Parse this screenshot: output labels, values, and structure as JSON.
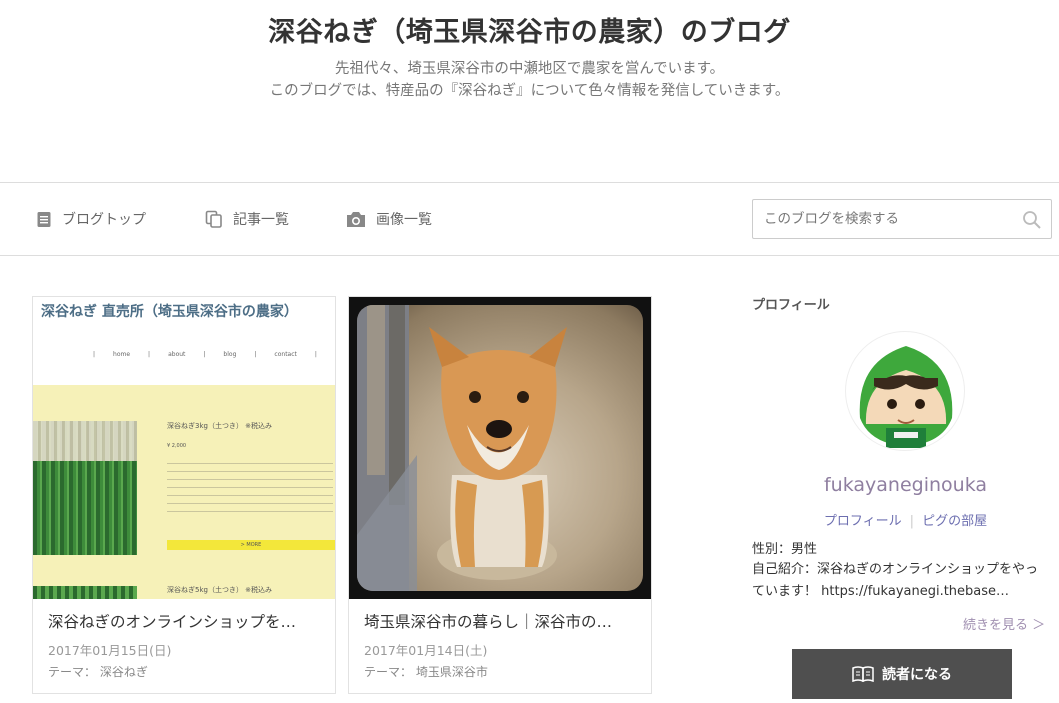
{
  "blog": {
    "title": "深谷ねぎ（埼玉県深谷市の農家）のブログ",
    "description_line1": "先祖代々、埼玉県深谷市の中瀬地区で農家を営んでいます。",
    "description_line2": "このブログでは、特産品の『深谷ねぎ』について色々情報を発信していきます。"
  },
  "nav": {
    "items": [
      {
        "label": "ブログトップ",
        "icon": "document-icon"
      },
      {
        "label": "記事一覧",
        "icon": "copy-icon"
      },
      {
        "label": "画像一覧",
        "icon": "camera-icon"
      }
    ],
    "search_placeholder": "このブログを検索する"
  },
  "articles": [
    {
      "title": "深谷ねぎのオンラインショップを…",
      "date": "2017年01月15日(日)",
      "theme_label": "テーマ：",
      "theme": "深谷ねぎ",
      "thumb": {
        "shop_title": "深谷ねぎ 直売所（埼玉県深谷市の農家）",
        "nav": [
          "home",
          "about",
          "blog",
          "contact"
        ],
        "product1": "深谷ねぎ3kg（土つき） ※税込み",
        "price": "¥ 2,000",
        "more": "> MORE",
        "product2": "深谷ねぎ5kg（土つき） ※税込み"
      }
    },
    {
      "title": "埼玉県深谷市の暮らし｜深谷市の…",
      "date": "2017年01月14日(土)",
      "theme_label": "テーマ：",
      "theme": "埼玉県深谷市"
    }
  ],
  "sidebar": {
    "heading": "プロフィール",
    "name": "fukayaneginouka",
    "links": [
      "プロフィール",
      "ピグの部屋"
    ],
    "gender": "性別：男性",
    "intro": "自己紹介：深谷ねぎのオンラインショップをやっています！ https://fukayanegi.thebase…",
    "read_more": "続きを見る ＞",
    "follow_label": "読者になる"
  },
  "colors": {
    "link": "#6d6fb0",
    "name": "#8f7fa0",
    "button_bg": "#4f4f4f",
    "shop_band": "#f6f1b8"
  }
}
